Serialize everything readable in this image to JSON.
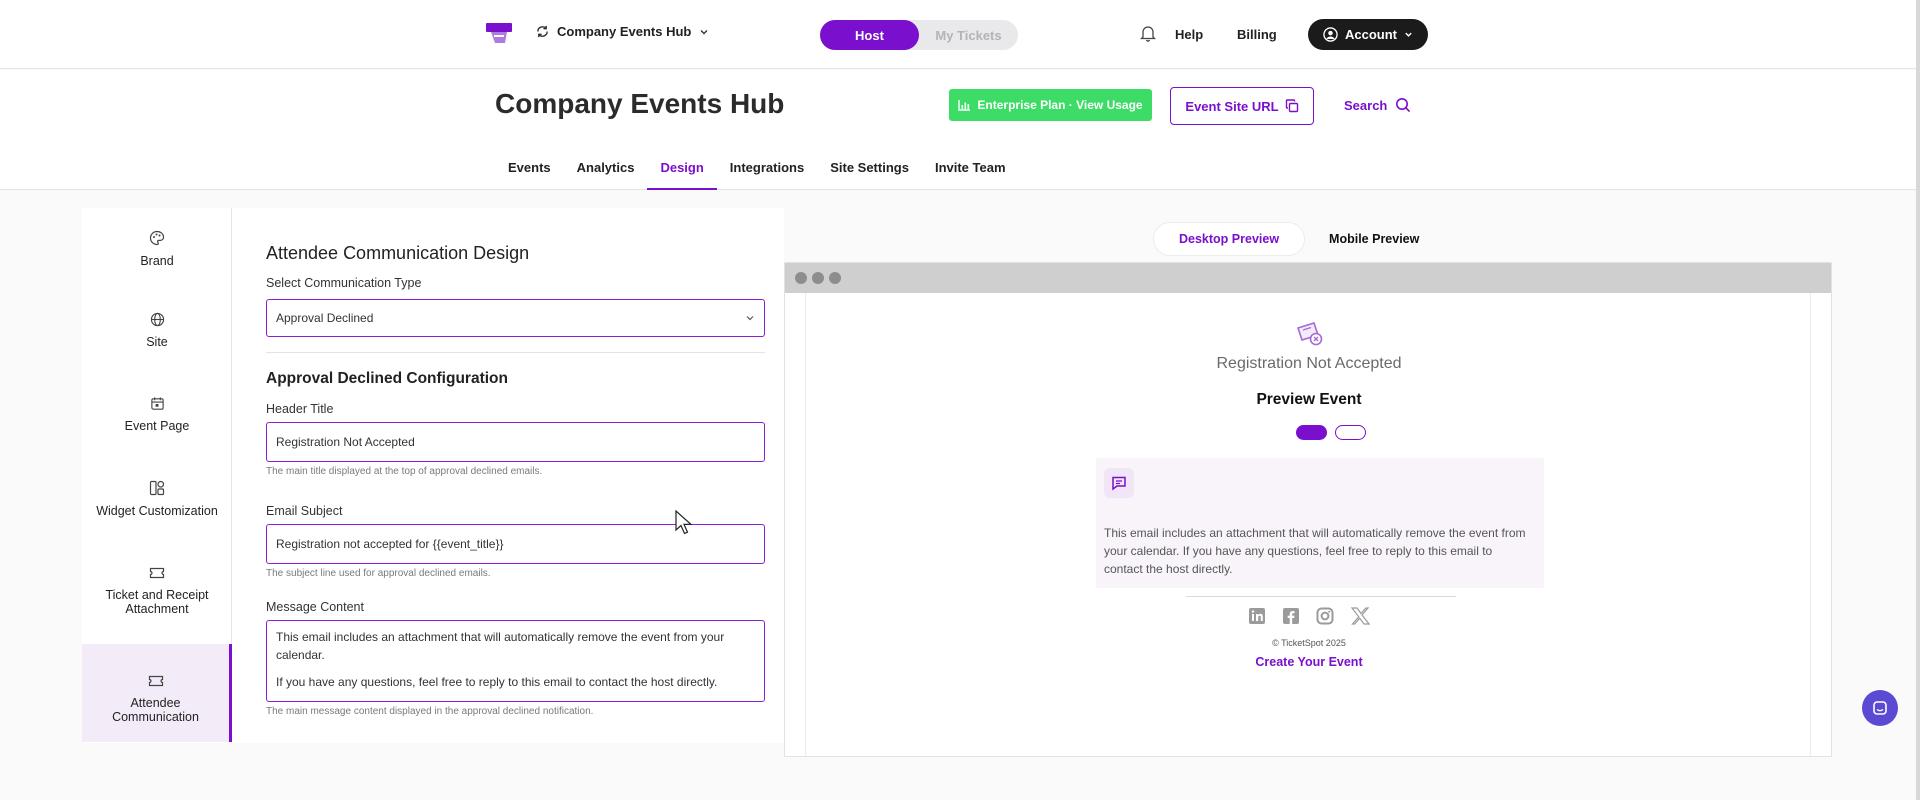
{
  "topnav": {
    "org_name": "Company Events Hub",
    "modes": [
      "Host",
      "My Tickets"
    ],
    "active_mode": "Host",
    "help": "Help",
    "billing": "Billing",
    "account": "Account"
  },
  "header": {
    "title": "Company Events Hub",
    "plan_button": "Enterprise Plan · View Usage",
    "site_url_button": "Event Site URL",
    "search": "Search",
    "tabs": [
      "Events",
      "Analytics",
      "Design",
      "Integrations",
      "Site Settings",
      "Invite Team"
    ],
    "active_tab": "Design"
  },
  "sidebar": {
    "items": [
      {
        "label": "Brand",
        "icon": "palette-icon"
      },
      {
        "label": "Site",
        "icon": "globe-icon"
      },
      {
        "label": "Event Page",
        "icon": "calendar-icon"
      },
      {
        "label": "Widget Customization",
        "icon": "widget-icon"
      },
      {
        "label": "Ticket and Receipt Attachment",
        "icon": "ticket-icon"
      },
      {
        "label": "Attendee Communication",
        "icon": "ticket-icon"
      }
    ],
    "active": "Attendee Communication"
  },
  "form": {
    "title": "Attendee Communication Design",
    "comm_type_label": "Select Communication Type",
    "comm_type_value": "Approval Declined",
    "section_title": "Approval Declined Configuration",
    "header_title_label": "Header Title",
    "header_title_value": "Registration Not Accepted",
    "header_title_help": "The main title displayed at the top of approval declined emails.",
    "email_subject_label": "Email Subject",
    "email_subject_value": "Registration not accepted for {{event_title}}",
    "email_subject_help": "The subject line used for approval declined emails.",
    "message_label": "Message Content",
    "message_line1": "This email includes an attachment that will automatically remove the event from your calendar.",
    "message_line2": "If you have any questions, feel free to reply to this email to contact the host directly.",
    "message_help": "The main message content displayed in the approval declined notification."
  },
  "preview": {
    "tabs": [
      "Desktop Preview",
      "Mobile Preview"
    ],
    "active_tab": "Desktop Preview",
    "email_header_title": "Registration Not Accepted",
    "event_name": "Preview Event",
    "message": "This email includes an attachment that will automatically remove the event from your calendar. If you have any questions, feel free to reply to this email to contact the host directly.",
    "copyright": "© TicketSpot 2025",
    "create_link": "Create Your Event",
    "socials": [
      "linkedin-icon",
      "facebook-icon",
      "instagram-icon",
      "x-icon"
    ]
  },
  "colors": {
    "accent": "#7a0fcd",
    "plan_green": "#3ddc66",
    "account_dark": "#1b1b1b"
  }
}
